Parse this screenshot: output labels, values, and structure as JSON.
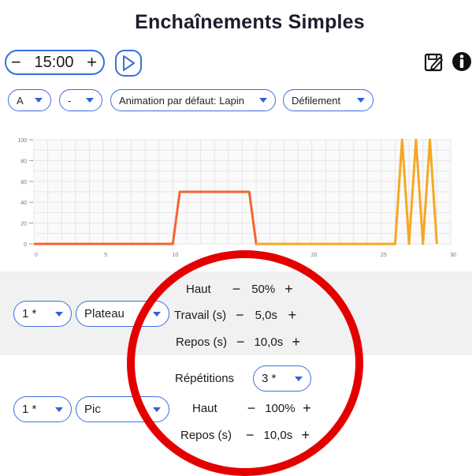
{
  "header": {
    "title": "Enchaînements Simples"
  },
  "timer": {
    "minus": "−",
    "value": "15:00",
    "plus": "+"
  },
  "icons": {
    "play": "play-icon",
    "save": "save-edit-icon",
    "info": "info-icon"
  },
  "toolbar": {
    "select_a": "A",
    "select_dash": "-",
    "animation": "Animation par défaut: Lapin",
    "scroll": "Défilement"
  },
  "chart_data": {
    "type": "line",
    "xlim": [
      0,
      30
    ],
    "ylim": [
      0,
      100
    ],
    "x_ticks": [
      "0",
      "5",
      "10",
      "15",
      "20",
      "25",
      "30"
    ],
    "y_ticks": [
      "0",
      "20",
      "40",
      "60",
      "80",
      "100"
    ],
    "grid": true,
    "series": [
      {
        "color": "#f2662f",
        "x": [
          0,
          10,
          10.5,
          15.5,
          16,
          26
        ],
        "y": [
          0,
          0,
          50,
          50,
          0,
          0
        ]
      },
      {
        "color": "#f7a723",
        "x": [
          16,
          26,
          26.5,
          27,
          27.5,
          28,
          28.5,
          29
        ],
        "y": [
          0,
          0,
          100,
          0,
          100,
          0,
          100,
          0
        ]
      }
    ]
  },
  "segment1": {
    "repeat": "1 *",
    "type": "Plateau",
    "rows": [
      {
        "label": "Haut",
        "minus": "−",
        "value": "50%",
        "plus": "+"
      },
      {
        "label": "Travail (s)",
        "minus": "−",
        "value": "5,0s",
        "plus": "+"
      },
      {
        "label": "Repos (s)",
        "minus": "−",
        "value": "10,0s",
        "plus": "+"
      }
    ]
  },
  "segment2": {
    "repeat": "1 *",
    "type": "Pic",
    "repetitions_label": "Répétitions",
    "repetitions_value": "3 *",
    "rows": [
      {
        "label": "Haut",
        "minus": "−",
        "value": "100%",
        "plus": "+"
      },
      {
        "label": "Repos (s)",
        "minus": "−",
        "value": "10,0s",
        "plus": "+"
      }
    ]
  },
  "annotation": {
    "color": "#e50000"
  }
}
